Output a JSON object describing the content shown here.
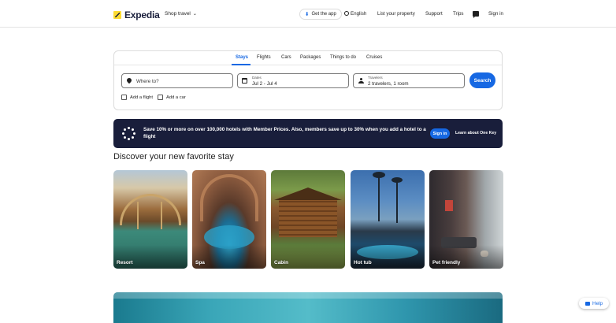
{
  "header": {
    "brand": "Expedia",
    "shop_travel": "Shop travel",
    "get_app": "Get the app",
    "language": "English",
    "list_property": "List your property",
    "support": "Support",
    "trips": "Trips",
    "sign_in": "Sign in"
  },
  "search": {
    "tabs": [
      "Stays",
      "Flights",
      "Cars",
      "Packages",
      "Things to do",
      "Cruises"
    ],
    "active_tab": "Stays",
    "destination_placeholder": "Where to?",
    "dates_label": "Dates",
    "dates_value": "Jul 2 - Jul 4",
    "travelers_label": "Travelers",
    "travelers_value": "2 travelers, 1 room",
    "search_button": "Search",
    "add_flight": "Add a flight",
    "add_car": "Add a car"
  },
  "banner": {
    "text": "Save 10% or more on over 100,000 hotels with Member Prices. Also, members save up to 30% when you add a hotel to a flight",
    "sign_in": "Sign in",
    "learn_more": "Learn about One Key"
  },
  "discover": {
    "title": "Discover your new favorite stay",
    "cards": [
      "Resort",
      "Spa",
      "Cabin",
      "Hot tub",
      "Pet friendly"
    ]
  },
  "help": {
    "label": "Help"
  },
  "colors": {
    "brand_navy": "#191e3b",
    "brand_yellow": "#fddb32",
    "accent_blue": "#1668e3"
  }
}
